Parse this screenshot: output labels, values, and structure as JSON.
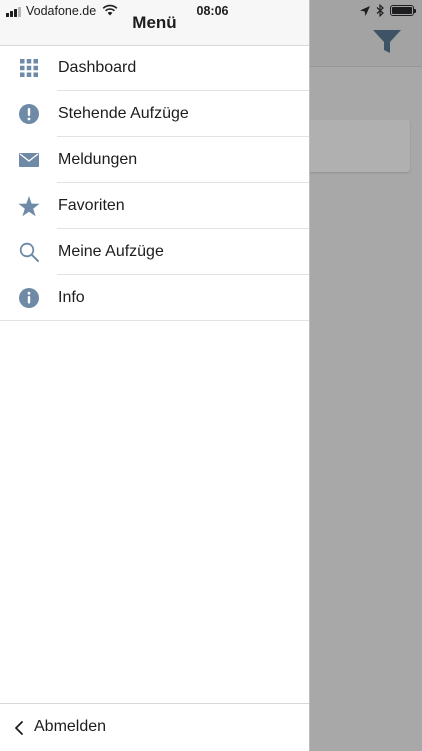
{
  "status_bar": {
    "carrier": "Vodafone.de",
    "time": "08:06"
  },
  "drawer": {
    "title": "Menü",
    "items": [
      {
        "label": "Dashboard",
        "icon": "grid-icon"
      },
      {
        "label": "Stehende Aufzüge",
        "icon": "exclamation-circle-icon"
      },
      {
        "label": "Meldungen",
        "icon": "envelope-icon"
      },
      {
        "label": "Favoriten",
        "icon": "star-icon"
      },
      {
        "label": "Meine Aufzüge",
        "icon": "search-icon"
      },
      {
        "label": "Info",
        "icon": "info-circle-icon"
      }
    ],
    "logout_label": "Abmelden"
  },
  "colors": {
    "icon": "#6e8aa6",
    "drawer_background": "#ffffff",
    "header_background": "#f7f7f7",
    "overlay": "#a8a8a8"
  }
}
